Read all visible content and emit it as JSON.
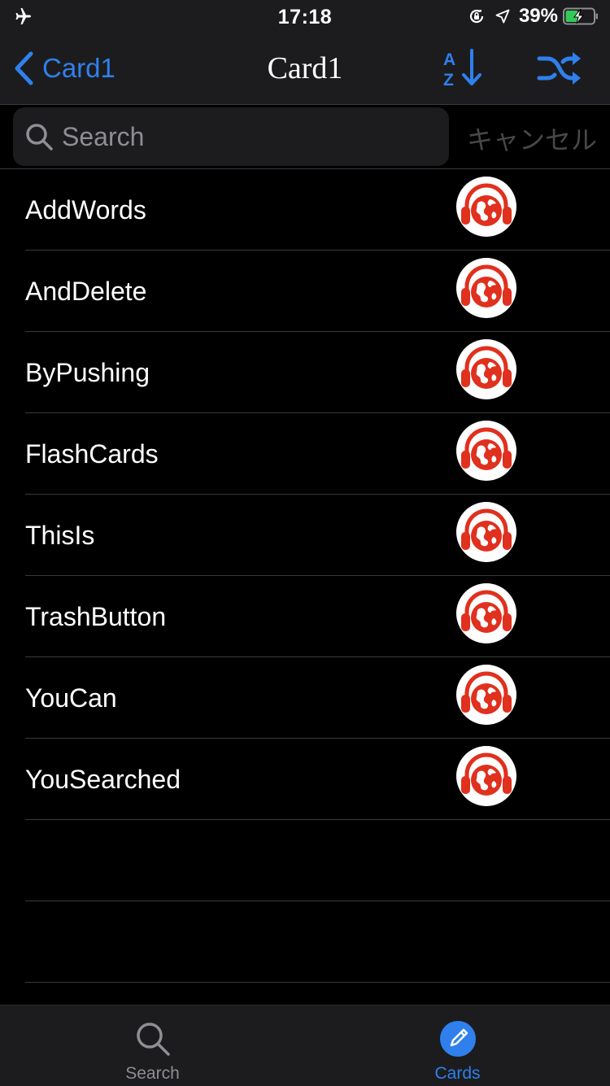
{
  "status_bar": {
    "time": "17:18",
    "battery_percent": "39%",
    "icons": [
      "airplane-icon",
      "orientation-lock-icon",
      "location-arrow-icon",
      "battery-charging-icon"
    ]
  },
  "nav": {
    "back_label": "Card1",
    "title": "Card1",
    "sort_icon": "sort-az-icon",
    "shuffle_icon": "shuffle-icon",
    "accent_color": "#2f80ed"
  },
  "search": {
    "placeholder": "Search",
    "value": "",
    "cancel_label": "キャンセル"
  },
  "list": {
    "items": [
      {
        "label": "AddWords"
      },
      {
        "label": "AndDelete"
      },
      {
        "label": "ByPushing"
      },
      {
        "label": "FlashCards"
      },
      {
        "label": "ThisIs"
      },
      {
        "label": "TrashButton"
      },
      {
        "label": "YouCan"
      },
      {
        "label": "YouSearched"
      }
    ],
    "item_icon": "audio-globe-icon",
    "icon_color": "#e0301e"
  },
  "tabbar": {
    "tabs": [
      {
        "label": "Search",
        "icon": "search-icon",
        "active": false
      },
      {
        "label": "Cards",
        "icon": "pencil-icon",
        "active": true
      }
    ]
  }
}
